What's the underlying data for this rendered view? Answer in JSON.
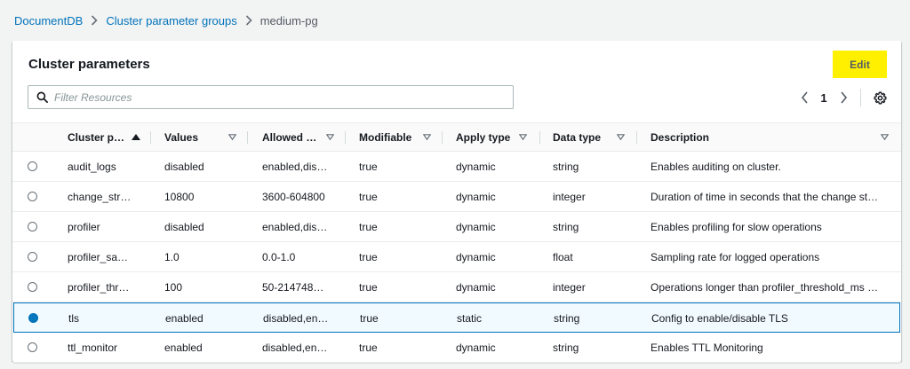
{
  "breadcrumb": {
    "items": [
      "DocumentDB",
      "Cluster parameter groups"
    ],
    "current": "medium-pg"
  },
  "panel": {
    "title": "Cluster parameters",
    "edit_label": "Edit"
  },
  "filter": {
    "placeholder": "Filter Resources",
    "value": ""
  },
  "pagination": {
    "current_page": "1"
  },
  "colors": {
    "accent": "#0073bb",
    "edit_highlight": "#fff000",
    "selected_row_bg": "#f1faff"
  },
  "table": {
    "columns": [
      "Cluster p…",
      "Values",
      "Allowed …",
      "Modifiable",
      "Apply type",
      "Data type",
      "Description"
    ],
    "sort": {
      "column": 0,
      "direction": "ascending"
    },
    "rows": [
      {
        "name": "audit_logs",
        "value": "disabled",
        "allowed": "enabled,dis…",
        "modifiable": "true",
        "apply": "dynamic",
        "type": "string",
        "description": "Enables auditing on cluster.",
        "selected": false
      },
      {
        "name": "change_str…",
        "value": "10800",
        "allowed": "3600-604800",
        "modifiable": "true",
        "apply": "dynamic",
        "type": "integer",
        "description": "Duration of time in seconds that the change st…",
        "selected": false
      },
      {
        "name": "profiler",
        "value": "disabled",
        "allowed": "enabled,dis…",
        "modifiable": "true",
        "apply": "dynamic",
        "type": "string",
        "description": "Enables profiling for slow operations",
        "selected": false
      },
      {
        "name": "profiler_sa…",
        "value": "1.0",
        "allowed": "0.0-1.0",
        "modifiable": "true",
        "apply": "dynamic",
        "type": "float",
        "description": "Sampling rate for logged operations",
        "selected": false
      },
      {
        "name": "profiler_thr…",
        "value": "100",
        "allowed": "50-214748…",
        "modifiable": "true",
        "apply": "dynamic",
        "type": "integer",
        "description": "Operations longer than profiler_threshold_ms …",
        "selected": false
      },
      {
        "name": "tls",
        "value": "enabled",
        "allowed": "disabled,en…",
        "modifiable": "true",
        "apply": "static",
        "type": "string",
        "description": "Config to enable/disable TLS",
        "selected": true
      },
      {
        "name": "ttl_monitor",
        "value": "enabled",
        "allowed": "disabled,en…",
        "modifiable": "true",
        "apply": "dynamic",
        "type": "string",
        "description": "Enables TTL Monitoring",
        "selected": false
      }
    ]
  }
}
